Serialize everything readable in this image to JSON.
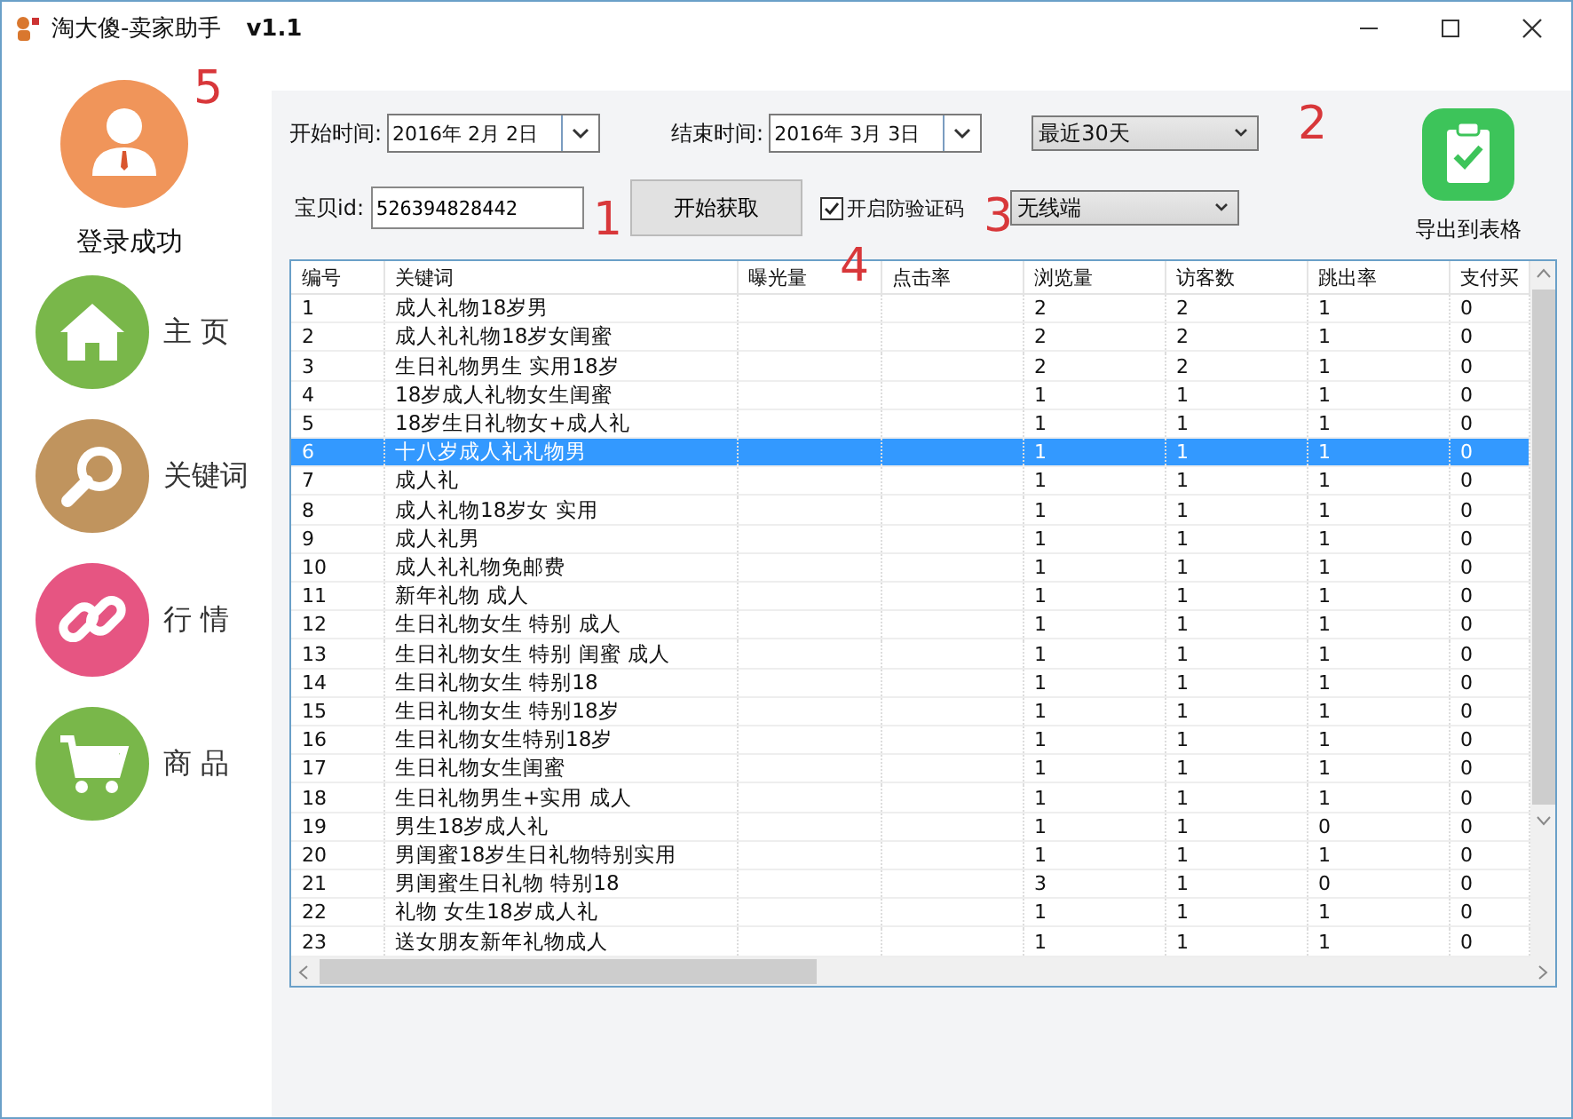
{
  "window": {
    "title": "淘大傻-卖家助手",
    "version": "v1.1"
  },
  "sidebar": {
    "login": {
      "label": "登录成功"
    },
    "items": [
      {
        "label": "主 页",
        "kind": "home",
        "color": "#79b74a"
      },
      {
        "label": "关键词",
        "kind": "search",
        "color": "#c0945e"
      },
      {
        "label": "行 情",
        "kind": "link",
        "color": "#e65582"
      },
      {
        "label": "商 品",
        "kind": "cart",
        "color": "#79b74a"
      }
    ]
  },
  "filters": {
    "start_label": "开始时间:",
    "start_date": "2016年 2月 2日",
    "end_label": "结束时间:",
    "end_date": "2016年 3月 3日",
    "range": "最近30天",
    "item_id_label": "宝贝id:",
    "item_id": "526394828442",
    "fetch_button": "开始获取",
    "captcha": {
      "label": "开启防验证码",
      "checked": true
    },
    "platform": "无线端"
  },
  "export": {
    "label": "导出到表格"
  },
  "annotations": [
    {
      "text": "5"
    },
    {
      "text": "2"
    },
    {
      "text": "1"
    },
    {
      "text": "3"
    },
    {
      "text": "4"
    }
  ],
  "table": {
    "columns": [
      "编号",
      "关键词",
      "曝光量",
      "点击率",
      "浏览量",
      "访客数",
      "跳出率",
      "支付买"
    ],
    "rows": [
      {
        "no": "1",
        "keyword": "成人礼物18岁男",
        "views": "2",
        "visitors": "2",
        "bounce": "1",
        "paid": "0",
        "selected": false
      },
      {
        "no": "2",
        "keyword": "成人礼礼物18岁女闺蜜",
        "views": "2",
        "visitors": "2",
        "bounce": "1",
        "paid": "0",
        "selected": false
      },
      {
        "no": "3",
        "keyword": "生日礼物男生 实用18岁",
        "views": "2",
        "visitors": "2",
        "bounce": "1",
        "paid": "0",
        "selected": false
      },
      {
        "no": "4",
        "keyword": "18岁成人礼物女生闺蜜",
        "views": "1",
        "visitors": "1",
        "bounce": "1",
        "paid": "0",
        "selected": false
      },
      {
        "no": "5",
        "keyword": "18岁生日礼物女+成人礼",
        "views": "1",
        "visitors": "1",
        "bounce": "1",
        "paid": "0",
        "selected": false
      },
      {
        "no": "6",
        "keyword": "十八岁成人礼礼物男",
        "views": "1",
        "visitors": "1",
        "bounce": "1",
        "paid": "0",
        "selected": true
      },
      {
        "no": "7",
        "keyword": "成人礼",
        "views": "1",
        "visitors": "1",
        "bounce": "1",
        "paid": "0",
        "selected": false
      },
      {
        "no": "8",
        "keyword": "成人礼物18岁女 实用",
        "views": "1",
        "visitors": "1",
        "bounce": "1",
        "paid": "0",
        "selected": false
      },
      {
        "no": "9",
        "keyword": "成人礼男",
        "views": "1",
        "visitors": "1",
        "bounce": "1",
        "paid": "0",
        "selected": false
      },
      {
        "no": "10",
        "keyword": "成人礼礼物免邮费",
        "views": "1",
        "visitors": "1",
        "bounce": "1",
        "paid": "0",
        "selected": false
      },
      {
        "no": "11",
        "keyword": "新年礼物 成人",
        "views": "1",
        "visitors": "1",
        "bounce": "1",
        "paid": "0",
        "selected": false
      },
      {
        "no": "12",
        "keyword": "生日礼物女生 特别 成人",
        "views": "1",
        "visitors": "1",
        "bounce": "1",
        "paid": "0",
        "selected": false
      },
      {
        "no": "13",
        "keyword": "生日礼物女生 特别 闺蜜 成人",
        "views": "1",
        "visitors": "1",
        "bounce": "1",
        "paid": "0",
        "selected": false
      },
      {
        "no": "14",
        "keyword": "生日礼物女生 特别18",
        "views": "1",
        "visitors": "1",
        "bounce": "1",
        "paid": "0",
        "selected": false
      },
      {
        "no": "15",
        "keyword": "生日礼物女生 特别18岁",
        "views": "1",
        "visitors": "1",
        "bounce": "1",
        "paid": "0",
        "selected": false
      },
      {
        "no": "16",
        "keyword": "生日礼物女生特别18岁",
        "views": "1",
        "visitors": "1",
        "bounce": "1",
        "paid": "0",
        "selected": false
      },
      {
        "no": "17",
        "keyword": "生日礼物女生闺蜜",
        "views": "1",
        "visitors": "1",
        "bounce": "1",
        "paid": "0",
        "selected": false
      },
      {
        "no": "18",
        "keyword": "生日礼物男生+实用 成人",
        "views": "1",
        "visitors": "1",
        "bounce": "1",
        "paid": "0",
        "selected": false
      },
      {
        "no": "19",
        "keyword": "男生18岁成人礼",
        "views": "1",
        "visitors": "1",
        "bounce": "0",
        "paid": "0",
        "selected": false
      },
      {
        "no": "20",
        "keyword": "男闺蜜18岁生日礼物特别实用",
        "views": "1",
        "visitors": "1",
        "bounce": "1",
        "paid": "0",
        "selected": false
      },
      {
        "no": "21",
        "keyword": "男闺蜜生日礼物 特别18",
        "views": "3",
        "visitors": "1",
        "bounce": "0",
        "paid": "0",
        "selected": false
      },
      {
        "no": "22",
        "keyword": "礼物 女生18岁成人礼",
        "views": "1",
        "visitors": "1",
        "bounce": "1",
        "paid": "0",
        "selected": false
      },
      {
        "no": "23",
        "keyword": "送女朋友新年礼物成人",
        "views": "1",
        "visitors": "1",
        "bounce": "1",
        "paid": "0",
        "selected": false
      }
    ]
  }
}
